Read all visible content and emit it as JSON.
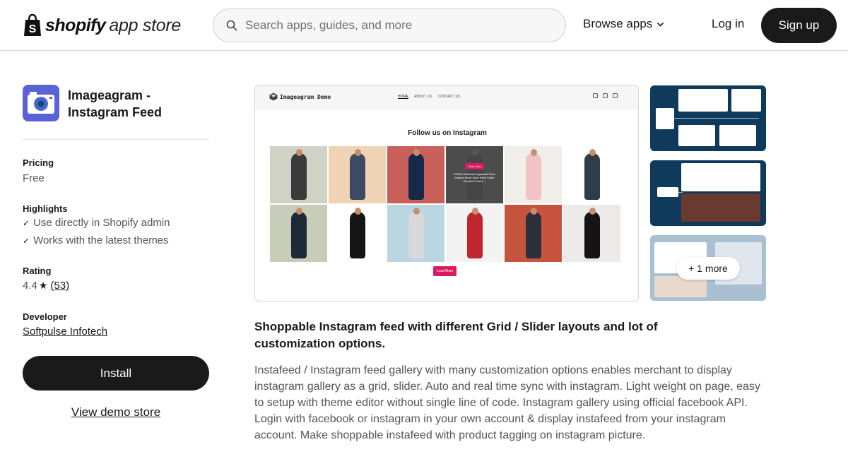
{
  "header": {
    "logo_word": "shopify",
    "logo_sub": "app store",
    "search_placeholder": "Search apps, guides, and more",
    "browse_label": "Browse apps",
    "login_label": "Log in",
    "signup_label": "Sign up"
  },
  "app": {
    "name": "Imageagram - Instagram Feed",
    "icon_color": "#5a63d6"
  },
  "sidebar": {
    "pricing_label": "Pricing",
    "pricing_value": "Free",
    "highlights_label": "Highlights",
    "highlights": [
      "Use directly in Shopify admin",
      "Works with the latest themes"
    ],
    "rating_label": "Rating",
    "rating_value": "4.4",
    "rating_count": "(53)",
    "developer_label": "Developer",
    "developer_name": "Softpulse Infotech",
    "install_label": "Install",
    "demo_label": "View demo store"
  },
  "screenshot": {
    "site_name": "Imageagram Demo",
    "nav": [
      "HOME",
      "ABOUT US",
      "CONTACT US"
    ],
    "heading": "Follow us on Instagram",
    "overlay_button": "Shop Now",
    "overlay_text": "SHEIN Waistcoat Highwaist Flare Elegant Mock Neck Semi Sheer Pleated Floral A...",
    "load_more": "Load More",
    "tiles": [
      {
        "bg": "#cfd2c4",
        "dress": "#3b3b3b"
      },
      {
        "bg": "#f0d3b4",
        "dress": "#3d4a66"
      },
      {
        "bg": "#c9605a",
        "dress": "#16294a"
      },
      {
        "bg": "#6a6a6a",
        "dress": "#444444"
      },
      {
        "bg": "#f1ede8",
        "dress": "#f1c3c6"
      },
      {
        "bg": "#ffffff",
        "dress": "#2f3e46"
      },
      {
        "bg": "#c8cdb9",
        "dress": "#1f2a36"
      },
      {
        "bg": "#ffffff",
        "dress": "#151515"
      },
      {
        "bg": "#b9d6e1",
        "dress": "#d9d9d9"
      },
      {
        "bg": "#f3f3f3",
        "dress": "#c0262e"
      },
      {
        "bg": "#c6533e",
        "dress": "#2d2f3a"
      },
      {
        "bg": "#ecebe8",
        "dress": "#141414"
      }
    ]
  },
  "gallery": {
    "more_label": "+ 1 more"
  },
  "description": {
    "title": "Shoppable Instagram feed with different Grid / Slider layouts and lot of customization options.",
    "body": "Instafeed / Instagram feed gallery with many customization options enables merchant to display instagram gallery as a grid, slider. Auto and real time sync with instagram. Light weight on page, easy to setup with theme editor without single line of code. Instagram gallery using official facebook API. Login with facebook or instagram in your own account & display instafeed from your instagram account. Make shoppable instafeed with product tagging on instagram picture."
  }
}
